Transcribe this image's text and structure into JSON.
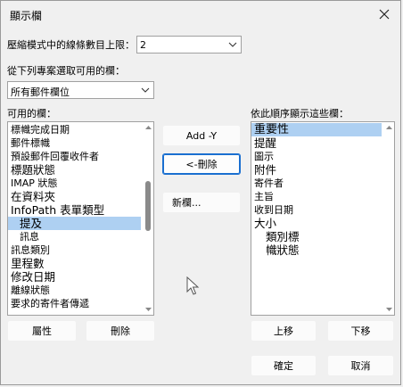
{
  "dialog": {
    "title": "顯示欄"
  },
  "max_lines": {
    "label": "壓縮模式中的線條數目上限：",
    "value": "2"
  },
  "source": {
    "label": "從下列專案選取可用的欄：",
    "selected": "所有郵件欄位"
  },
  "available": {
    "label": "可用的欄：",
    "items": [
      "標幟完成日期",
      "郵件標幟",
      "預設郵件回覆收件者",
      "標題狀態",
      "IMAP 狀態",
      "在資料夾",
      "InfoPath 表單類型",
      "提及",
      "訊息",
      "訊息類別",
      "里程數",
      "修改日期",
      "離線狀態",
      "要求的寄件者傳遞"
    ]
  },
  "buttons": {
    "add": "Add -Y",
    "remove": "<-刪除",
    "new_column": "新欄...",
    "properties": "屬性",
    "delete": "刪除",
    "move_up": "上移",
    "move_down": "下移",
    "ok": "確定",
    "cancel": "取消"
  },
  "ordered": {
    "label": "依此順序顯示這些欄：",
    "items": [
      "重要性",
      "提醒",
      "圖示",
      "附件",
      "寄件者",
      "主旨",
      "收到日期",
      "大小",
      "類別標",
      "幟狀態"
    ]
  },
  "icons": {
    "close": "close-icon",
    "dropdown": "chevron-down-icon",
    "cursor": "mouse-pointer-icon"
  },
  "colors": {
    "selection": "#aed0f2",
    "focus_border": "#1a6fd0"
  }
}
